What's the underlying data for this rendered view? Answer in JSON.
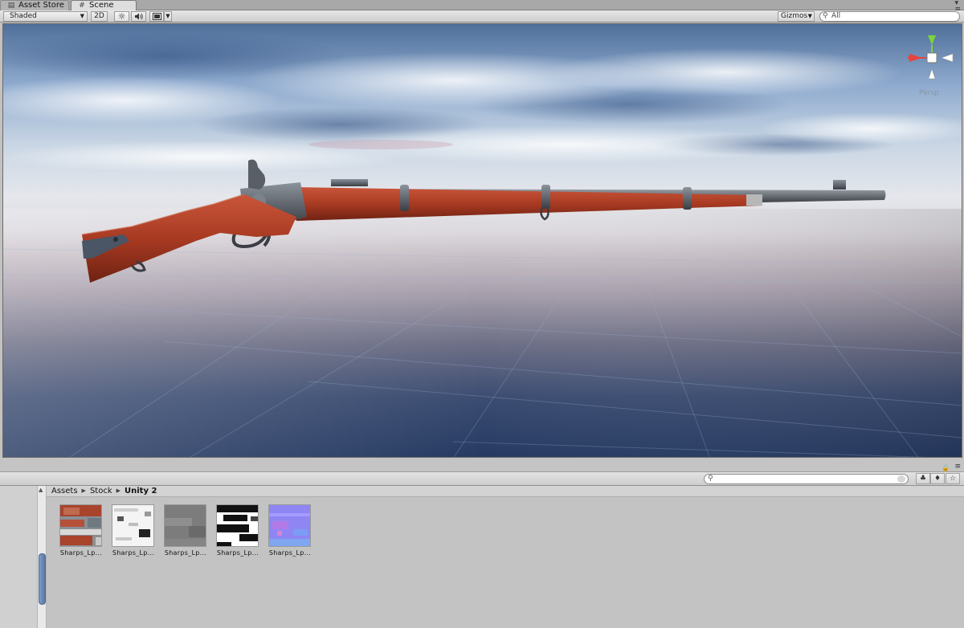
{
  "tabs": [
    {
      "label": "Asset Store",
      "icon": "shopping-bag-icon"
    },
    {
      "label": "Scene",
      "icon": "hash-grid-icon",
      "active": true
    }
  ],
  "scene_toolbar": {
    "shading_mode": "Shaded",
    "mode_2d": "2D",
    "gizmos_label": "Gizmos",
    "search_placeholder": "All"
  },
  "viewport": {
    "projection_label": "Persp",
    "axis_colors": {
      "x": "#e8443c",
      "y": "#7cd43a",
      "z": "#4a6fd0"
    }
  },
  "project": {
    "breadcrumb": [
      "Assets",
      "Stock",
      "Unity 2"
    ],
    "assets": [
      {
        "label": "Sharps_Lp...",
        "kind": "diffuse-texture"
      },
      {
        "label": "Sharps_Lp...",
        "kind": "specular-texture"
      },
      {
        "label": "Sharps_Lp...",
        "kind": "gray-mask-texture"
      },
      {
        "label": "Sharps_Lp...",
        "kind": "bw-mask-texture"
      },
      {
        "label": "Sharps_Lp...",
        "kind": "normal-map-texture"
      }
    ]
  }
}
